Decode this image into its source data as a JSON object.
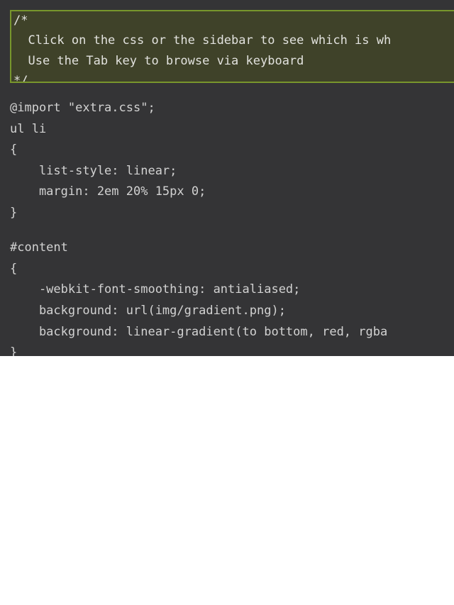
{
  "editor": {
    "background_color": "#343436",
    "text_color": "#d2d2d2",
    "comment_block": {
      "background_color": "#3f4229",
      "border_color": "#78962c",
      "lines": [
        {
          "text": "/*",
          "indent": 0
        },
        {
          "text": "  Click on the css or the sidebar to see which is wh",
          "indent": 0
        },
        {
          "text": "  Use the Tab key to browse via keyboard",
          "indent": 0
        },
        {
          "text": "*/",
          "indent": 0
        }
      ]
    },
    "css_lines": [
      {
        "text": "@import \"extra.css\";"
      },
      {
        "text": "ul li"
      },
      {
        "text": "{"
      },
      {
        "text": "    list-style: linear;"
      },
      {
        "text": "    margin: 2em 20% 15px 0;"
      },
      {
        "text": "}"
      },
      {
        "text": ""
      },
      {
        "text": "#content"
      },
      {
        "text": "{"
      },
      {
        "text": "    -webkit-font-smoothing: antialiased;"
      },
      {
        "text": "    background: url(img/gradient.png);"
      },
      {
        "text": "    background: linear-gradient(to bottom, red, rgba"
      },
      {
        "text": "}"
      }
    ]
  },
  "page": {
    "body_background_color": "#ffffff"
  }
}
